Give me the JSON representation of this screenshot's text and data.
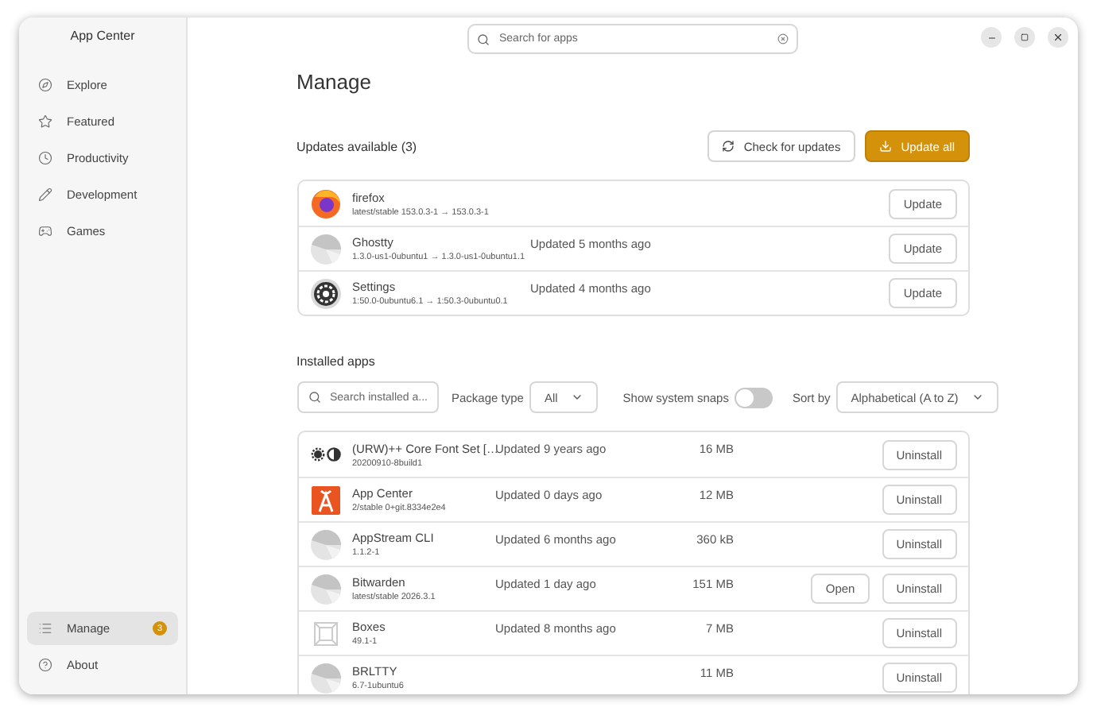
{
  "window": {
    "title": "App Center"
  },
  "sidebar": {
    "items": [
      {
        "label": "Explore",
        "selected": false
      },
      {
        "label": "Featured",
        "selected": false
      },
      {
        "label": "Productivity",
        "selected": false
      },
      {
        "label": "Development",
        "selected": false
      },
      {
        "label": "Games",
        "selected": false
      }
    ],
    "bottom_items": [
      {
        "label": "Manage",
        "selected": true,
        "badge": "3"
      },
      {
        "label": "About",
        "selected": false
      }
    ]
  },
  "search": {
    "placeholder": "Search for apps"
  },
  "page_title": "Manage",
  "updates": {
    "heading": "Updates available (3)",
    "check_button": "Check for updates",
    "update_all_button": "Update all",
    "rows": [
      {
        "name": "firefox",
        "version": "latest/stable 153.0.3-1 → 153.0.3-1",
        "kind": "firefox",
        "button": "Update"
      },
      {
        "name": "Ghostty",
        "version": "1.3.0-us1-0ubuntu1 → 1.3.0-us1-0ubuntu1.1",
        "updated": "Updated 5 months ago",
        "kind": "generic",
        "button": "Update"
      },
      {
        "name": "Settings",
        "version": "1:50.0-0ubuntu6.1 → 1:50.3-0ubuntu0.1",
        "updated": "Updated 4 months ago",
        "kind": "gear",
        "button": "Update"
      }
    ]
  },
  "installed": {
    "heading": "Installed apps",
    "search_placeholder": "Search installed a...",
    "package_type_label": "Package type",
    "package_type_value": "All",
    "system_snaps_label": "Show system snaps",
    "system_snaps_on": false,
    "sort_label": "Sort by",
    "sort_value": "Alphabetical (A to Z)",
    "rows": [
      {
        "name": "(URW)++ Core Font Set […",
        "version": "20200910-8build1",
        "updated": "Updated 9 years ago",
        "size": "16 MB",
        "kind": "font",
        "button": "Uninstall"
      },
      {
        "name": "App Center",
        "version": "2/stable 0+git.8334e2e4",
        "updated": "Updated 0 days ago",
        "size": "12 MB",
        "kind": "appcenter",
        "button": "Uninstall"
      },
      {
        "name": "AppStream CLI",
        "version": "1.1.2-1",
        "updated": "Updated 6 months ago",
        "size": "360 kB",
        "kind": "generic",
        "button": "Uninstall"
      },
      {
        "name": "Bitwarden",
        "version": "latest/stable 2026.3.1",
        "updated": "Updated 1 day ago",
        "size": "151 MB",
        "kind": "generic",
        "open_button": "Open",
        "button": "Uninstall"
      },
      {
        "name": "Boxes",
        "version": "49.1-1",
        "updated": "Updated 8 months ago",
        "size": "7 MB",
        "kind": "boxes",
        "button": "Uninstall"
      },
      {
        "name": "BRLTTY",
        "version": "6.7-1ubuntu6",
        "size": "11 MB",
        "kind": "generic",
        "button": "Uninstall"
      }
    ]
  }
}
